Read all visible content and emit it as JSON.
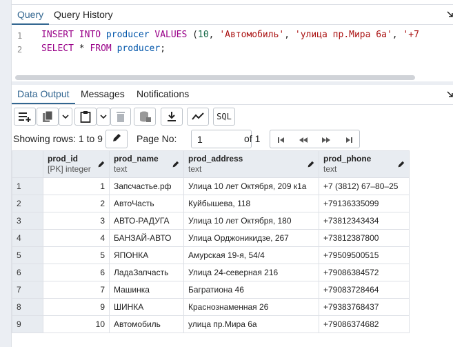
{
  "query_tabs": [
    "Query",
    "Query History"
  ],
  "code": {
    "line_numbers": [
      "1",
      "2"
    ],
    "line1": {
      "kw1": "INSERT INTO ",
      "id1": "producer",
      "kw2": " VALUES ",
      "p1": "(",
      "n1": "10",
      "p2": ", ",
      "s1": "'Автомобиль'",
      "p3": ", ",
      "s2": "'улица пр.Мира 6а'",
      "p4": ", ",
      "s3": "'+7"
    },
    "line2": {
      "kw1": "SELECT ",
      "p1": "* ",
      "kw2": "FROM ",
      "id1": "producer",
      "p2": ";"
    }
  },
  "output_tabs": [
    "Data Output",
    "Messages",
    "Notifications"
  ],
  "toolbar": {
    "sql_label": "SQL",
    "icons": [
      "add-row-icon",
      "copy-icon",
      "chevron-down-icon",
      "paste-icon",
      "chevron-down-icon",
      "delete-icon",
      "save-data-icon",
      "download-icon",
      "graph-icon"
    ]
  },
  "pager": {
    "showing": "Showing rows: 1 to 9",
    "page_no_label": "Page No:",
    "page_value": "1",
    "of_label": "of 1"
  },
  "grid": {
    "columns": [
      {
        "name": "prod_id",
        "type": "[PK] integer"
      },
      {
        "name": "prod_name",
        "type": "text"
      },
      {
        "name": "prod_address",
        "type": "text"
      },
      {
        "name": "prod_phone",
        "type": "text"
      }
    ],
    "rows": [
      {
        "rn": "1",
        "id": "1",
        "name": "Запсчастье.рф",
        "address": "Улица 10 лет Октября, 209 к1а",
        "phone": "+7 (3812) 67–80–25"
      },
      {
        "rn": "2",
        "id": "2",
        "name": "АвтоЧасть",
        "address": "Куйбышева, 118",
        "phone": "+79136335099"
      },
      {
        "rn": "3",
        "id": "3",
        "name": "АВТО-РАДУГА",
        "address": "Улица 10 лет Октября, 180",
        "phone": "+73812343434"
      },
      {
        "rn": "4",
        "id": "4",
        "name": "БАНЗАЙ-АВТО",
        "address": "Улица Орджоникидзе, 267",
        "phone": "+73812387800"
      },
      {
        "rn": "5",
        "id": "5",
        "name": "ЯПОНКА",
        "address": "Амурская 19-я, 54/4",
        "phone": "+79509500515"
      },
      {
        "rn": "6",
        "id": "6",
        "name": "ЛадаЗапчасть",
        "address": "Улица 24-северная 216",
        "phone": "+79086384572"
      },
      {
        "rn": "7",
        "id": "7",
        "name": "Машинка",
        "address": "Багратиона 46",
        "phone": "+79083728464"
      },
      {
        "rn": "8",
        "id": "9",
        "name": "ШИНКА",
        "address": "Краснознаменная 26",
        "phone": "+79383768437"
      },
      {
        "rn": "9",
        "id": "10",
        "name": "Автомобиль",
        "address": "улица пр.Мира 6а",
        "phone": "+79086374682"
      }
    ]
  },
  "colors": {
    "accent": "#326690",
    "header_bg": "#e8ecf1",
    "border": "#dde0e6"
  }
}
